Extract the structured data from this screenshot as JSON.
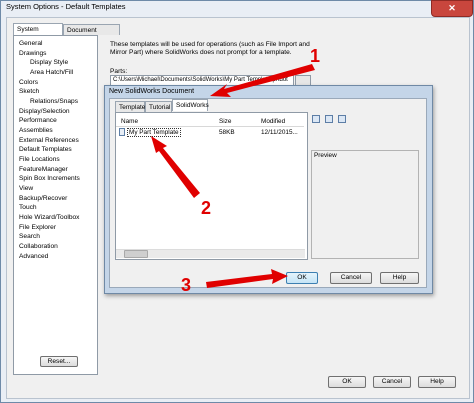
{
  "window": {
    "title": "System Options - Default Templates"
  },
  "tabs": [
    "System Options",
    "Document Properties"
  ],
  "tree": {
    "items": [
      {
        "label": "General",
        "indent": 0
      },
      {
        "label": "Drawings",
        "indent": 0
      },
      {
        "label": "Display Style",
        "indent": 1
      },
      {
        "label": "Area Hatch/Fill",
        "indent": 1
      },
      {
        "label": "Colors",
        "indent": 0
      },
      {
        "label": "Sketch",
        "indent": 0
      },
      {
        "label": "Relations/Snaps",
        "indent": 1
      },
      {
        "label": "Display/Selection",
        "indent": 0
      },
      {
        "label": "Performance",
        "indent": 0
      },
      {
        "label": "Assemblies",
        "indent": 0
      },
      {
        "label": "External References",
        "indent": 0
      },
      {
        "label": "Default Templates",
        "indent": 0
      },
      {
        "label": "File Locations",
        "indent": 0
      },
      {
        "label": "FeatureManager",
        "indent": 0
      },
      {
        "label": "Spin Box Increments",
        "indent": 0
      },
      {
        "label": "View",
        "indent": 0
      },
      {
        "label": "Backup/Recover",
        "indent": 0
      },
      {
        "label": "Touch",
        "indent": 0
      },
      {
        "label": "Hole Wizard/Toolbox",
        "indent": 0
      },
      {
        "label": "File Explorer",
        "indent": 0
      },
      {
        "label": "Search",
        "indent": 0
      },
      {
        "label": "Collaboration",
        "indent": 0
      },
      {
        "label": "Advanced",
        "indent": 0
      }
    ]
  },
  "main": {
    "description": "These templates will be used for operations (such as File Import and Mirror Part) where SolidWorks does not prompt for a template.",
    "parts_label": "Parts:",
    "parts_path": "C:\\Users\\Michael\\Documents\\SolidWorks\\My Part Template.prtdot"
  },
  "buttons": {
    "reset": "Reset...",
    "ok": "OK",
    "cancel": "Cancel",
    "help": "Help"
  },
  "dialog": {
    "title": "New SolidWorks Document",
    "tabs": [
      "Templates",
      "Tutorial",
      "SolidWorks"
    ],
    "columns": [
      "Name",
      "Size",
      "Modified"
    ],
    "files": [
      {
        "name": "My Part Template",
        "size": "58KB",
        "modified": "12/11/2015..."
      }
    ],
    "preview_label": "Preview",
    "ok": "OK",
    "cancel": "Cancel",
    "help": "Help"
  },
  "annotations": [
    "1",
    "2",
    "3"
  ],
  "colors": {
    "annotation": "#e00000",
    "title_bar": "#c4d5e8"
  }
}
